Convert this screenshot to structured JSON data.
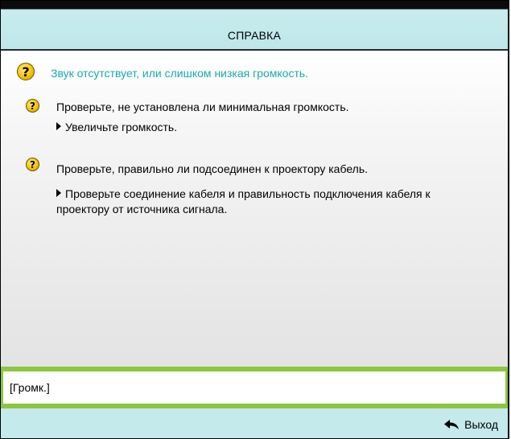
{
  "window": {
    "title": "СПРАВКА"
  },
  "help": {
    "topic": "Звук отсутствует, или слишком низкая громкость.",
    "items": [
      {
        "check": "Проверьте, не установлена ли минимальная громкость.",
        "action": "Увеличьте громкость."
      },
      {
        "check": "Проверьте, правильно ли подсоединен к проектору кабель.",
        "action_line1": "Проверьте соединение кабеля и правильность подключения кабеля к",
        "action_line2": "проектору от источника сигнала."
      }
    ]
  },
  "volume": {
    "label": "[Громк.]"
  },
  "footer": {
    "exit_label": "Выход",
    "exit_icon": "return-arrow-icon"
  },
  "colors": {
    "header_bg": "#bde7ea",
    "topic_text": "#1aa9b4",
    "volume_border": "#8dc63f",
    "footer_bg": "#c4eaec",
    "question_icon": "#f5c400"
  },
  "icons": {
    "question": "question-icon",
    "bullet": "triangle-bullet-icon"
  }
}
